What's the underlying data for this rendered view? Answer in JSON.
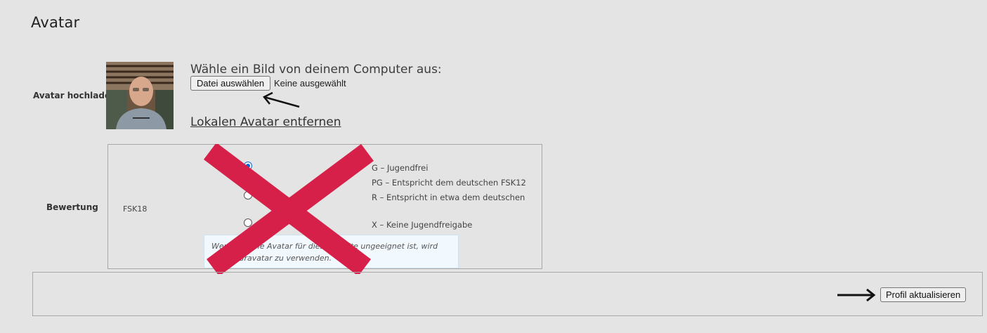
{
  "page": {
    "title": "Avatar"
  },
  "upload": {
    "row_label": "Avatar hochladen",
    "prompt": "Wähle ein Bild von deinem Computer aus:",
    "file_button": "Datei auswählen",
    "file_status": "Keine ausgewählt",
    "remove_link": "Lokalen Avatar entfernen"
  },
  "rating": {
    "row_label": "Bewertung",
    "group_label": "FSK18",
    "options": [
      {
        "text": "G – Jugendfrei",
        "selected": true
      },
      {
        "text": "PG – Entspricht dem deutschen FSK12",
        "selected": false
      },
      {
        "text": "R – Entspricht in etwa dem deutschen",
        "selected": false
      },
      {
        "text": "X – Keine Jugendfreigabe",
        "selected": false
      }
    ],
    "hint_line1": "Wenn      kale Avatar für diese      eite ungeeignet ist, wird",
    "hint_line2": "v       , Gravatar zu verwenden."
  },
  "footer": {
    "submit_button": "Profil aktualisieren"
  },
  "colors": {
    "cross": "#d6204a",
    "radio_checked": "#0b67d4",
    "hint_bg": "#f1f8fe"
  }
}
